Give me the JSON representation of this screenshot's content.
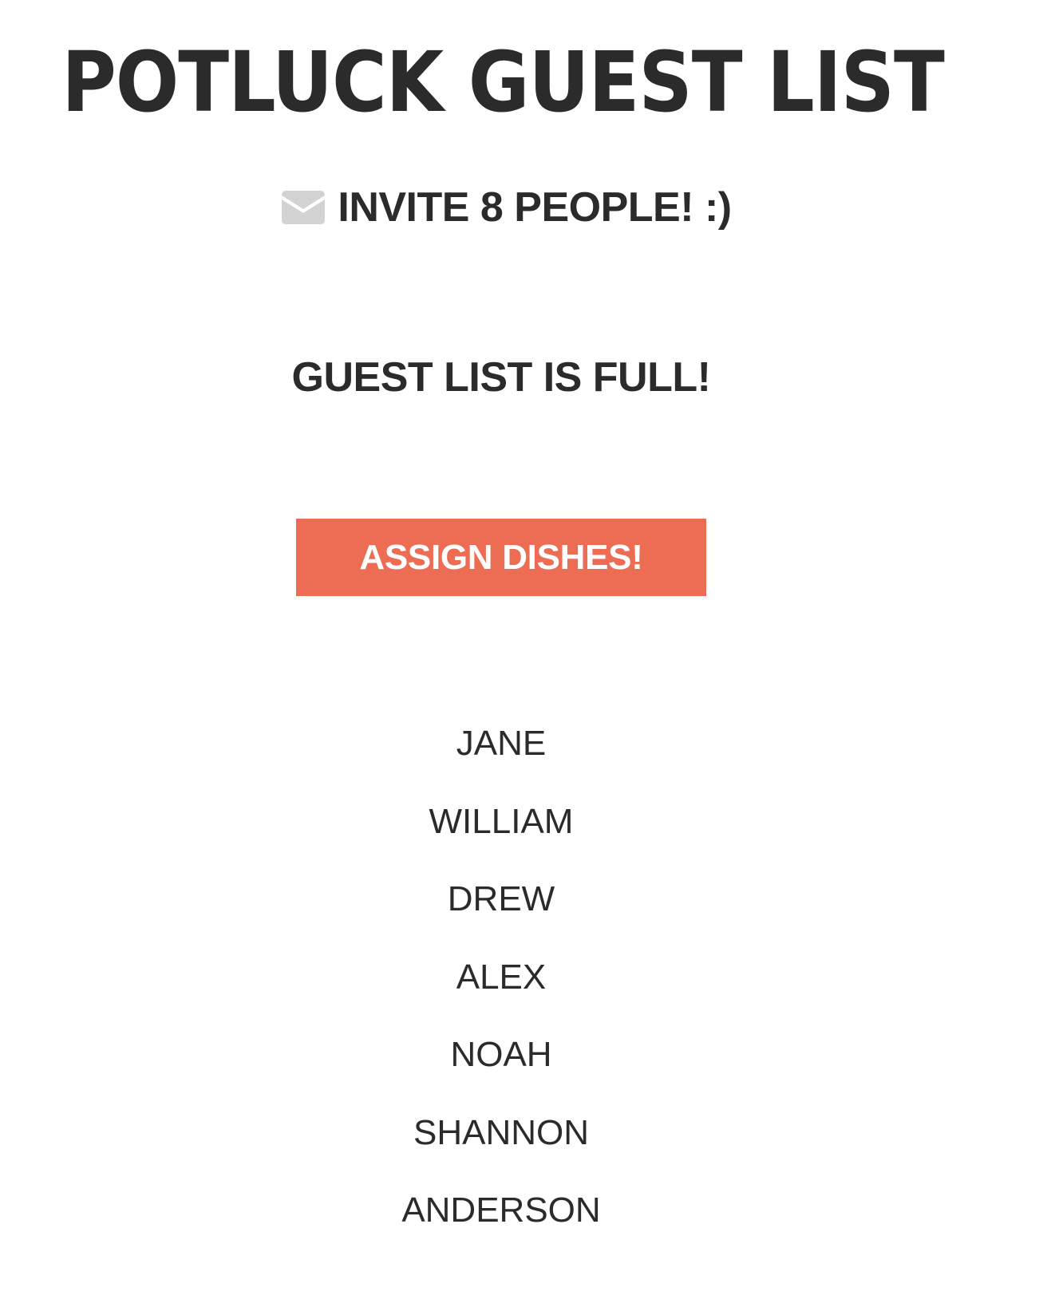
{
  "header": {
    "title": "POTLUCK GUEST LIST"
  },
  "invite": {
    "icon": "envelope-icon",
    "icon_color": "#d3d3d3",
    "text": "INVITE 8 PEOPLE! :)"
  },
  "status": {
    "message": "GUEST LIST IS FULL!"
  },
  "actions": {
    "assign_label": "ASSIGN DISHES!",
    "assign_color": "#ed6d54"
  },
  "guests": [
    "JANE",
    "WILLIAM",
    "DREW",
    "ALEX",
    "NOAH",
    "SHANNON",
    "ANDERSON"
  ]
}
